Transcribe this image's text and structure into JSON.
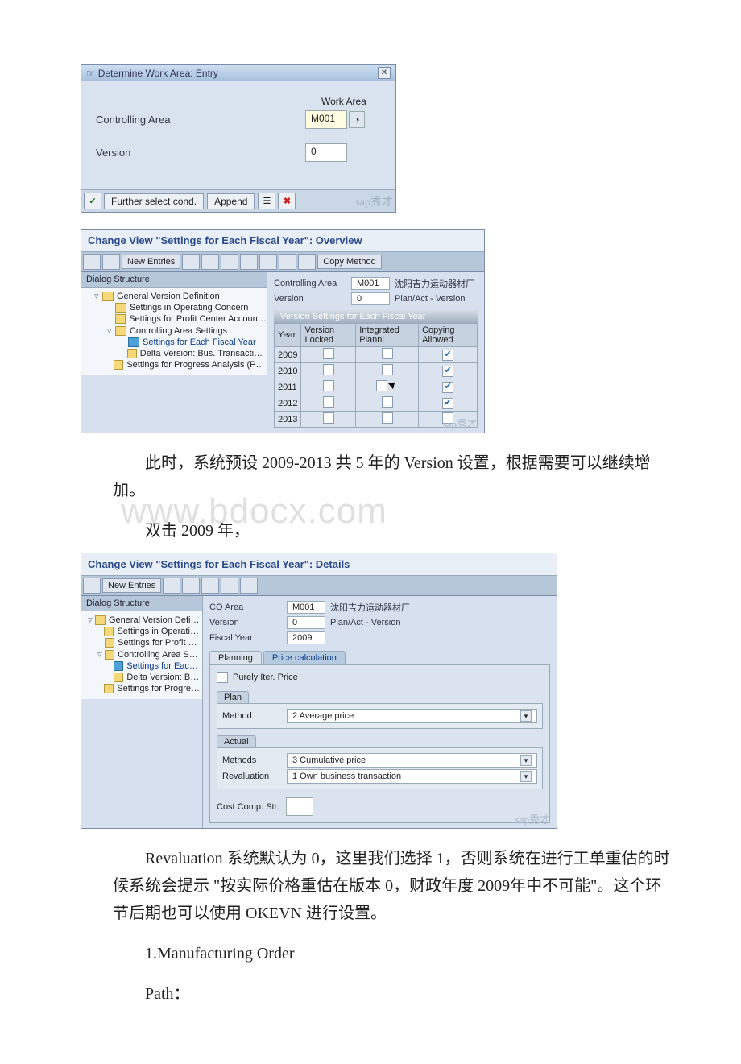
{
  "dialog1": {
    "title": "Determine Work Area: Entry",
    "wa_label": "Work Area",
    "ca_label": "Controlling Area",
    "ca_value": "M001",
    "ver_label": "Version",
    "ver_value": "0",
    "ok": "✔",
    "further": "Further select cond.",
    "append": "Append",
    "watermark": "sap秀才"
  },
  "view1": {
    "title": "Change View \"Settings for Each Fiscal Year\": Overview",
    "new_entries": "New Entries",
    "copy_method": "Copy Method",
    "ds_title": "Dialog Structure",
    "tree": {
      "t0": "General Version Definition",
      "t1": "Settings in Operating Concern",
      "t2": "Settings for Profit Center Accounting",
      "t3": "Controlling Area Settings",
      "t4": "Settings for Each Fiscal Year",
      "t5": "Delta Version: Bus. Transactions from",
      "t6": "Settings for Progress Analysis (Project Sys"
    },
    "ca_label": "Controlling Area",
    "ca_val": "M001",
    "ca_txt": "沈阳吉力运动器材厂",
    "ver_label": "Version",
    "ver_val": "0",
    "ver_txt": "Plan/Act - Version",
    "sec": "Version Settings for Each Fiscal Year",
    "cols": {
      "c1": "Year",
      "c2": "Version Locked",
      "c3": "Integrated Planni",
      "c4": "Copying Allowed"
    },
    "rows": [
      {
        "year": "2009",
        "locked": false,
        "int": false,
        "copy": true
      },
      {
        "year": "2010",
        "locked": false,
        "int": false,
        "copy": true
      },
      {
        "year": "2011",
        "locked": false,
        "int": false,
        "copy": true
      },
      {
        "year": "2012",
        "locked": false,
        "int": false,
        "copy": true
      },
      {
        "year": "2013",
        "locked": false,
        "int": false,
        "copy": false
      }
    ],
    "watermark": "sap秀才"
  },
  "para1": "此时，系统预设 2009-2013 共 5 年的 Version 设置，根据需要可以继续增加。",
  "para2": "双击 2009 年，",
  "bg_watermark": "www.bdocx.com",
  "view2": {
    "title": "Change View \"Settings for Each Fiscal Year\": Details",
    "new_entries": "New Entries",
    "ds_title": "Dialog Structure",
    "tree": {
      "t0": "General Version Definition",
      "t1": "Settings in Operating Con",
      "t2": "Settings for Profit Center",
      "t3": "Controlling Area Settings",
      "t4": "Settings for Each Fisca",
      "t5": "Delta Version: Bus. Tra",
      "t6": "Settings for Progress Anal"
    },
    "co_label": "CO Area",
    "co_val": "M001",
    "co_txt": "沈阳吉力运动器材厂",
    "ver_label": "Version",
    "ver_val": "0",
    "ver_txt": "Plan/Act - Version",
    "fy_label": "Fiscal Year",
    "fy_val": "2009",
    "tab1": "Planning",
    "tab2": "Price calculation",
    "purely": "Purely Iter. Price",
    "plan_head": "Plan",
    "method_lbl": "Method",
    "method_val": "2 Average price",
    "actual_head": "Actual",
    "methods_lbl": "Methods",
    "methods_val": "3 Cumulative price",
    "reval_lbl": "Revaluation",
    "reval_val": "1 Own business transaction",
    "cc_lbl": "Cost Comp. Str.",
    "watermark": "sap秀才"
  },
  "para3": "Revaluation 系统默认为 0，这里我们选择 1，否则系统在进行工单重估的时候系统会提示 \"按实际价格重估在版本 0，财政年度 2009年中不可能\"。这个环节后期也可以使用 OKEVN 进行设置。",
  "para4": "1.Manufacturing Order",
  "para5": "Path："
}
